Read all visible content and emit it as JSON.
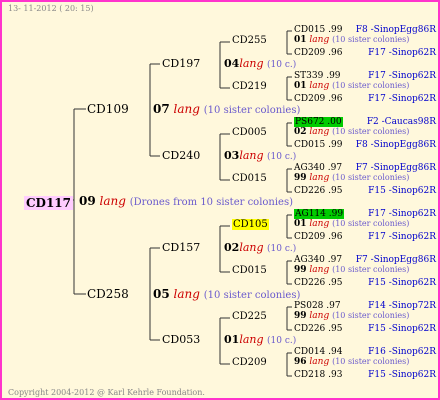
{
  "header": {
    "date": "13- 11-2012 ( 20: 15)"
  },
  "footer": {
    "copyright": "Copyright 2004-2012 @ Karl Kehrle Foundation."
  },
  "root": {
    "id": "CD117",
    "num": "09",
    "lang": "lang",
    "desc": "(Drones from 10 sister colonies)"
  },
  "l1": [
    {
      "id": "CD109",
      "num": "07",
      "lang": "lang",
      "desc": "(10 sister colonies)"
    },
    {
      "id": "CD258",
      "num": "05",
      "lang": "lang",
      "desc": "(10 sister colonies)"
    }
  ],
  "l2": [
    {
      "id": "CD197",
      "num": "04",
      "lang": "lang",
      "desc": "(10 c.)"
    },
    {
      "id": "CD240",
      "num": "03",
      "lang": "lang",
      "desc": "(10 c.)"
    },
    {
      "id": "CD157",
      "num": "02",
      "lang": "lang",
      "desc": "(10 c.)"
    },
    {
      "id": "CD053",
      "num": "01",
      "lang": "lang",
      "desc": "(10 c.)"
    }
  ],
  "l3": [
    {
      "id": "CD255",
      "num": "01",
      "lang": "lang",
      "desc": "(10 sister colonies)"
    },
    {
      "id": "CD219",
      "num": "01",
      "lang": "lang",
      "desc": "(10 sister colonies)"
    },
    {
      "id": "CD005",
      "num": "02",
      "lang": "lang",
      "desc": "(10 sister colonies)"
    },
    {
      "id": "CD015",
      "num": "99",
      "lang": "lang",
      "desc": "(10 sister colonies)"
    },
    {
      "id": "CD105",
      "num": "01",
      "lang": "lang",
      "desc": "(10 sister colonies)"
    },
    {
      "id": "CD015",
      "num": "99",
      "lang": "lang",
      "desc": "(10 sister colonies)"
    },
    {
      "id": "CD225",
      "num": "99",
      "lang": "lang",
      "desc": "(10 sister colonies)"
    },
    {
      "id": "CD209",
      "num": "96",
      "lang": "lang",
      "desc": "(10 sister colonies)"
    }
  ],
  "l4": [
    {
      "id": "CD015 .99",
      "line": "F8 -SinopEgg86R"
    },
    {
      "id": "CD209 .96",
      "line": "F17 -Sinop62R"
    },
    {
      "id": "ST339 .99",
      "line": "F17 -Sinop62R"
    },
    {
      "id": "CD209 .96",
      "line": "F17 -Sinop62R"
    },
    {
      "id": "PS672 .00",
      "line": "F2 -Caucas98R"
    },
    {
      "id": "CD015 .99",
      "line": "F8 -SinopEgg86R"
    },
    {
      "id": "AG340 .97",
      "line": "F7 -SinopEgg86R"
    },
    {
      "id": "CD226 .95",
      "line": "F15 -Sinop62R"
    },
    {
      "id": "AG114 .99",
      "line": "F17 -Sinop62R"
    },
    {
      "id": "CD209 .96",
      "line": "F17 -Sinop62R"
    },
    {
      "id": "AG340 .97",
      "line": "F7 -SinopEgg86R"
    },
    {
      "id": "CD226 .95",
      "line": "F15 -Sinop62R"
    },
    {
      "id": "PS028 .97",
      "line": "F14 -Sinop72R"
    },
    {
      "id": "CD226 .95",
      "line": "F15 -Sinop62R"
    },
    {
      "id": "CD014 .94",
      "line": "F16 -Sinop62R"
    },
    {
      "id": "CD218 .93",
      "line": "F15 -Sinop62R"
    }
  ]
}
